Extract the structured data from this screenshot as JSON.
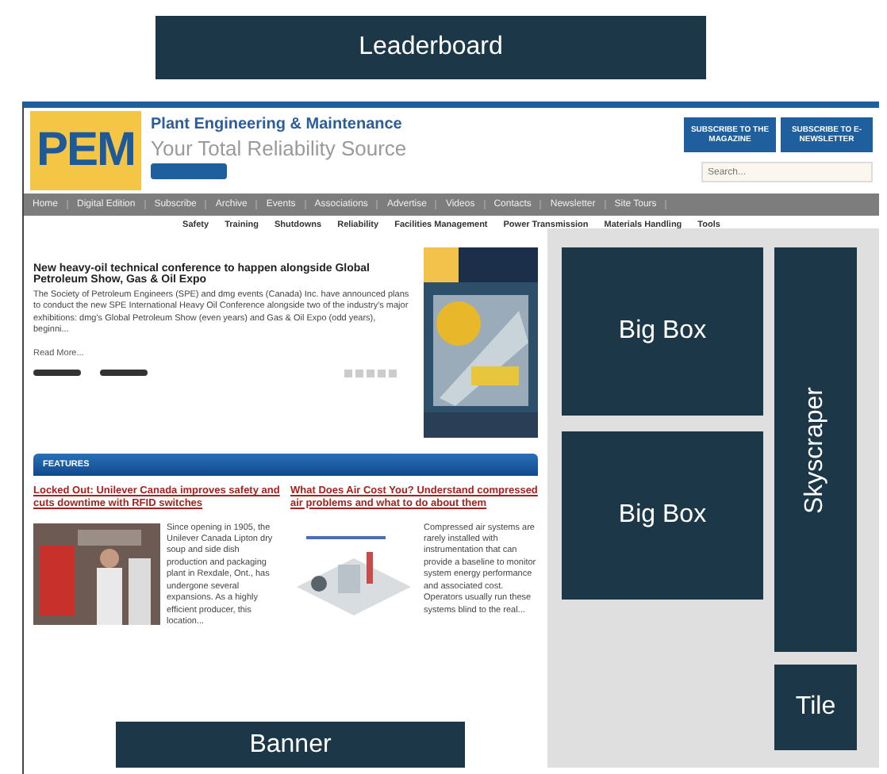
{
  "leaderboard": {
    "label": "Leaderboard"
  },
  "site": {
    "logo": "PEM",
    "title": "Plant Engineering & Maintenance",
    "tagline": "Your Total Reliability Source",
    "header_buttons": [
      "SUBSCRIBE TO THE MAGAZINE",
      "SUBSCRIBE TO E-NEWSLETTER"
    ],
    "search": {
      "placeholder": "Search..."
    },
    "nav": [
      "Home",
      "Digital Edition",
      "Subscribe",
      "Archive",
      "Events",
      "Associations",
      "Advertise",
      "Videos",
      "Contacts",
      "Newsletter",
      "Site Tours"
    ],
    "subnav": [
      "Safety",
      "Training",
      "Shutdowns",
      "Reliability",
      "Facilities Management",
      "Power Transmission",
      "Materials Handling",
      "Tools"
    ],
    "article": {
      "headline": "New heavy-oil technical conference to happen alongside Global Petroleum Show, Gas & Oil Expo",
      "body": "The Society of Petroleum Engineers (SPE) and dmg events (Canada) Inc. have announced plans to conduct the new SPE International Heavy Oil Conference alongside two of the industry's major exhibitions: dmg's Global Petroleum Show (even years) and Gas & Oil Expo (odd years), beginni...",
      "read_more": "Read More..."
    },
    "features_heading": "FEATURES",
    "features": [
      {
        "title": "Locked Out: Unilever Canada improves safety and cuts downtime with RFID switches",
        "text": "Since opening in 1905, the Unilever Canada Lipton dry soup and side dish production and packaging plant in Rexdale, Ont., has undergone several expansions. As a highly efficient producer, this location..."
      },
      {
        "title": "What Does Air Cost You? Understand compressed air problems and what to do about them",
        "text": "Compressed air systems are rarely installed with instrumentation that can provide a baseline to monitor system energy performance and associated cost. Operators usually run these systems blind to the real..."
      }
    ]
  },
  "ads": {
    "big_boxes": [
      "Big Box",
      "Big Box"
    ],
    "skyscraper": "Skyscraper",
    "tile": "Tile",
    "banner": "Banner"
  }
}
